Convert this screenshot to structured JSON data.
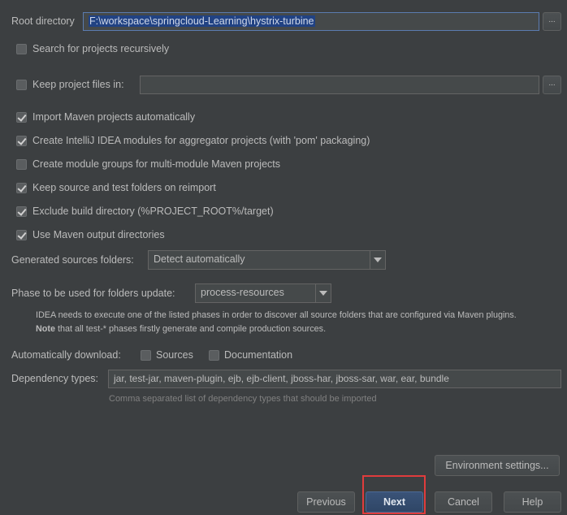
{
  "root_directory": {
    "label": "Root directory",
    "value": "F:\\workspace\\springcloud-Learning\\hystrix-turbine",
    "browse": "..."
  },
  "keep_project_files": {
    "label": "Keep project files in:",
    "value": "",
    "browse": "...",
    "checked": false
  },
  "checkboxes": [
    {
      "label": "Search for projects recursively",
      "checked": false
    },
    {
      "label": "Import Maven projects automatically",
      "checked": true
    },
    {
      "label": "Create IntelliJ IDEA modules for aggregator projects (with 'pom' packaging)",
      "checked": true
    },
    {
      "label": "Create module groups for multi-module Maven projects",
      "checked": false
    },
    {
      "label": "Keep source and test folders on reimport",
      "checked": true
    },
    {
      "label": "Exclude build directory (%PROJECT_ROOT%/target)",
      "checked": true
    },
    {
      "label": "Use Maven output directories",
      "checked": true
    }
  ],
  "generated_sources": {
    "label": "Generated sources folders:",
    "value": "Detect automatically"
  },
  "phase": {
    "label": "Phase to be used for folders update:",
    "value": "process-resources"
  },
  "note": {
    "line1": "IDEA needs to execute one of the listed phases in order to discover all source folders that are configured via Maven plugins.",
    "bold": "Note",
    "line2": " that all test-* phases firstly generate and compile production sources."
  },
  "auto_download": {
    "label": "Automatically download:",
    "sources": "Sources",
    "documentation": "Documentation",
    "sources_checked": false,
    "documentation_checked": false
  },
  "dependency_types": {
    "label": "Dependency types:",
    "value": "jar, test-jar, maven-plugin, ejb, ejb-client, jboss-har, jboss-sar, war, ear, bundle",
    "hint": "Comma separated list of dependency types that should be imported"
  },
  "buttons": {
    "environment": "Environment settings...",
    "previous": "Previous",
    "next": "Next",
    "cancel": "Cancel",
    "help": "Help"
  },
  "highlight_color": "#e03c3c"
}
